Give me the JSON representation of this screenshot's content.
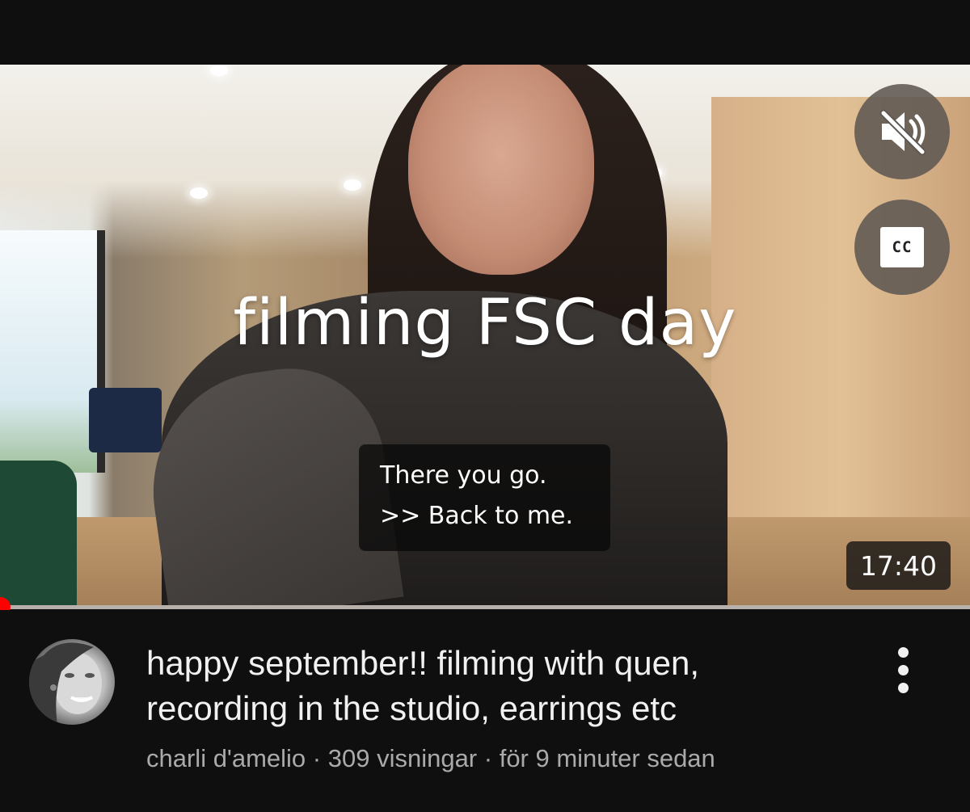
{
  "video": {
    "overlay_title": "filming FSC day",
    "captions": [
      "There you go.",
      ">> Back to me."
    ],
    "duration": "17:40",
    "cc_label": "CC",
    "progress_fraction": 0.0
  },
  "meta": {
    "title_line1": "happy september!! filming with quen,",
    "title_line2": "recording in the studio, earrings etc",
    "channel": "charli d'amelio",
    "views": "309 visningar",
    "age": "för 9 minuter sedan",
    "separator": " · "
  },
  "icons": {
    "mute": "volume-muted-icon",
    "cc": "closed-captions-icon",
    "more": "more-vertical-icon"
  },
  "colors": {
    "background": "#0f0f0f",
    "progress": "#ff0000"
  }
}
